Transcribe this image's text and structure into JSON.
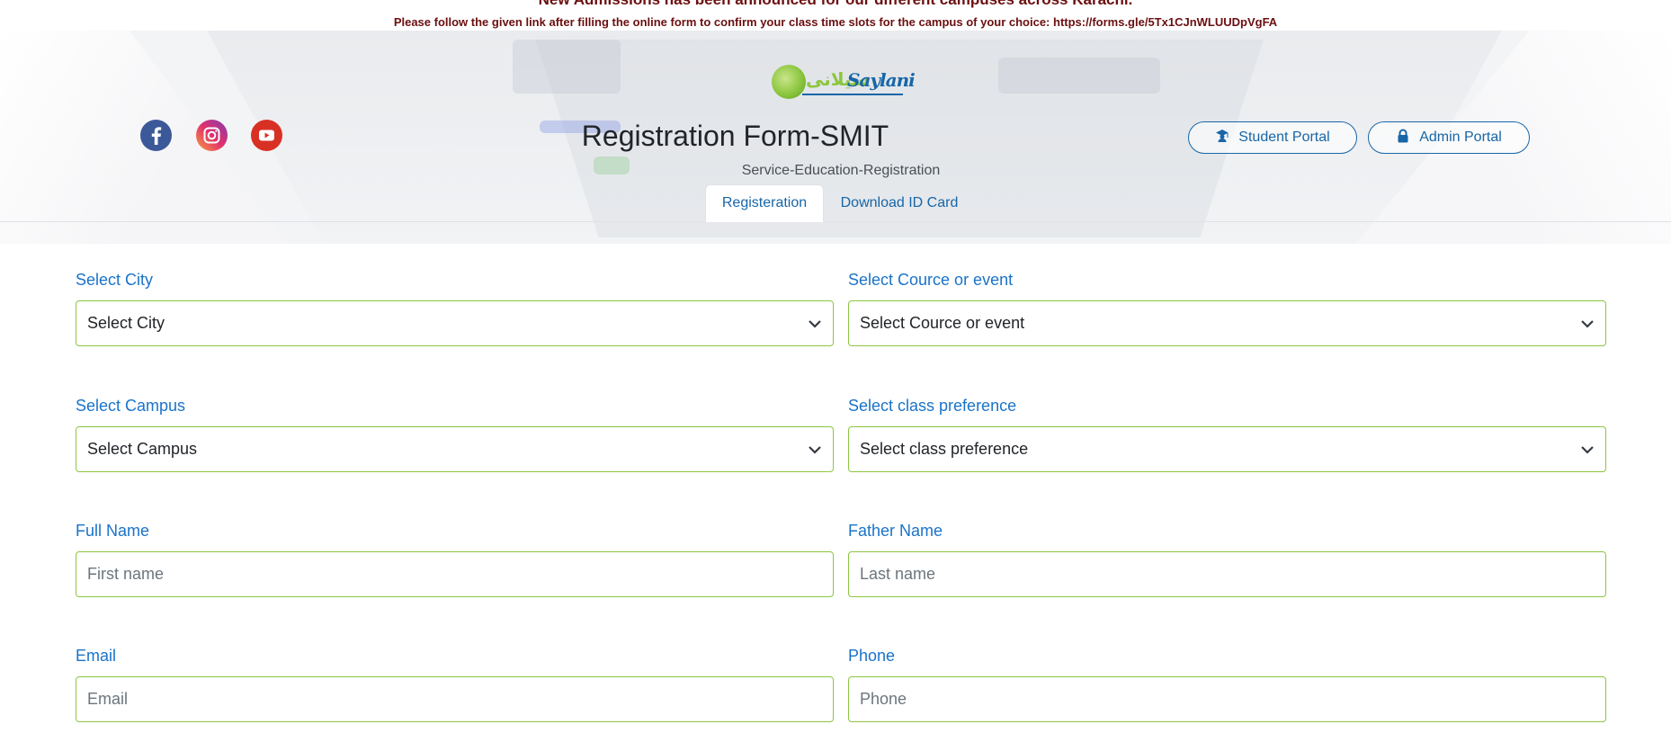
{
  "announcement": {
    "headline": "New Admissions has been announced for our different campuses across Karachi.",
    "note": "Please follow the given link after filling the online form to confirm your class time slots for the campus of your choice: https://forms.gle/5Tx1CJnWLUUDpVgFA"
  },
  "brand": {
    "logo_text": "Saylani",
    "logo_urdu": "سیلانی",
    "colors": {
      "green": "#8cc63f",
      "blue": "#1766a7",
      "label_blue": "#1a73c8",
      "announce_red": "#6b0f10"
    }
  },
  "social": [
    {
      "name": "facebook-icon",
      "color": "#3b5998"
    },
    {
      "name": "instagram-icon",
      "color": "#c13584"
    },
    {
      "name": "youtube-icon",
      "color": "#d93025"
    }
  ],
  "header": {
    "title": "Registration Form-SMIT",
    "subtitle": "Service-Education-Registration"
  },
  "portals": {
    "student": {
      "label": "Student Portal",
      "icon": "graduate-icon"
    },
    "admin": {
      "label": "Admin Portal",
      "icon": "lock-icon"
    }
  },
  "tabs": [
    {
      "label": "Registeration",
      "active": true
    },
    {
      "label": "Download ID Card",
      "active": false
    }
  ],
  "form": {
    "city": {
      "label": "Select City",
      "value": "Select City"
    },
    "course": {
      "label": "Select Cource or event",
      "value": "Select Cource or event"
    },
    "campus": {
      "label": "Select Campus",
      "value": "Select Campus"
    },
    "class_pref": {
      "label": "Select class preference",
      "value": "Select class preference"
    },
    "full_name": {
      "label": "Full Name",
      "placeholder": "First name"
    },
    "father_name": {
      "label": "Father Name",
      "placeholder": "Last name"
    },
    "email": {
      "label": "Email",
      "placeholder": "Email"
    },
    "phone": {
      "label": "Phone",
      "placeholder": "Phone"
    }
  }
}
